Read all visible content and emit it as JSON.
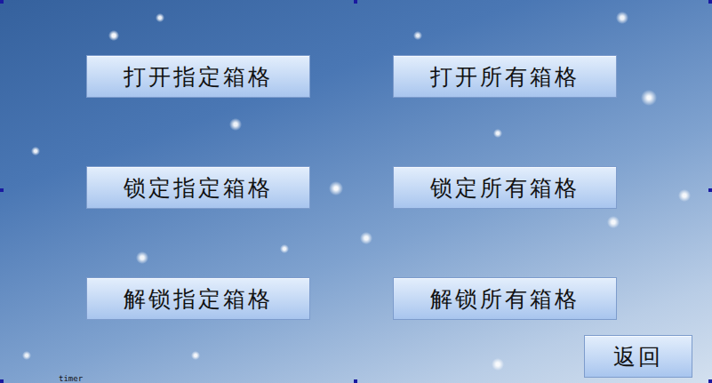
{
  "buttons": [
    {
      "label": "打开指定箱格"
    },
    {
      "label": "打开所有箱格"
    },
    {
      "label": "锁定指定箱格"
    },
    {
      "label": "锁定所有箱格"
    },
    {
      "label": "解锁指定箱格"
    },
    {
      "label": "解锁所有箱格"
    }
  ],
  "back_button": "返回",
  "timer_label": "timer"
}
